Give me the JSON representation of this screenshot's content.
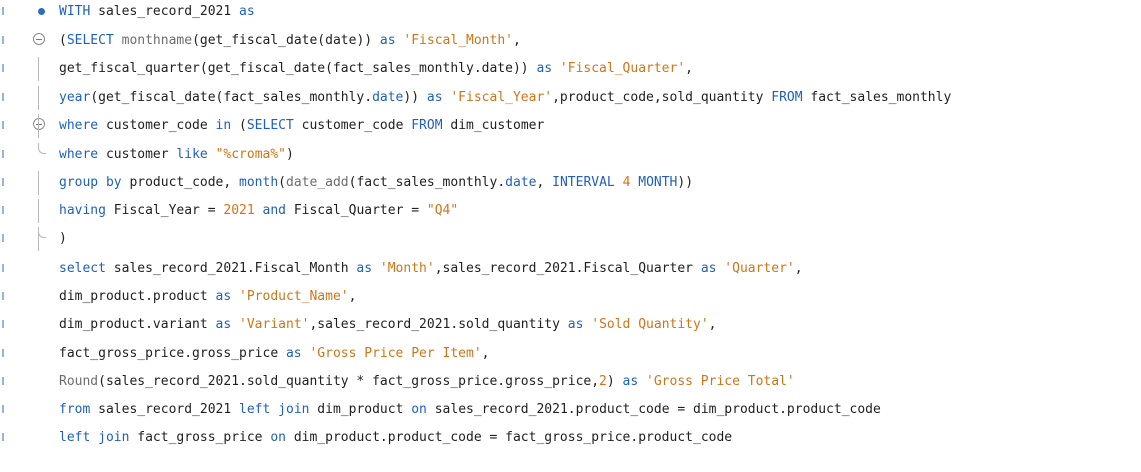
{
  "editor": {
    "lines": [
      [
        {
          "t": "WITH",
          "c": "kw"
        },
        {
          "t": " sales_record_2021 ",
          "c": "plain"
        },
        {
          "t": "as",
          "c": "kw"
        }
      ],
      [
        {
          "t": "(",
          "c": "plain"
        },
        {
          "t": "SELECT",
          "c": "kw"
        },
        {
          "t": " ",
          "c": "plain"
        },
        {
          "t": "monthname",
          "c": "fn"
        },
        {
          "t": "(get_fiscal_date(date)) ",
          "c": "plain"
        },
        {
          "t": "as",
          "c": "kw"
        },
        {
          "t": " ",
          "c": "plain"
        },
        {
          "t": "'Fiscal_Month'",
          "c": "str"
        },
        {
          "t": ",",
          "c": "plain"
        }
      ],
      [
        {
          "t": "get_fiscal_quarter(get_fiscal_date(fact_sales_monthly.date)) ",
          "c": "plain"
        },
        {
          "t": "as",
          "c": "kw"
        },
        {
          "t": " ",
          "c": "plain"
        },
        {
          "t": "'Fiscal_Quarter'",
          "c": "str"
        },
        {
          "t": ",",
          "c": "plain"
        }
      ],
      [
        {
          "t": "year",
          "c": "kw"
        },
        {
          "t": "(get_fiscal_date(fact_sales_monthly.",
          "c": "plain"
        },
        {
          "t": "date",
          "c": "kw"
        },
        {
          "t": ")) ",
          "c": "plain"
        },
        {
          "t": "as",
          "c": "kw"
        },
        {
          "t": " ",
          "c": "plain"
        },
        {
          "t": "'Fiscal_Year'",
          "c": "str"
        },
        {
          "t": ",product_code,sold_quantity ",
          "c": "plain"
        },
        {
          "t": "FROM",
          "c": "kw"
        },
        {
          "t": " fact_sales_monthly",
          "c": "plain"
        }
      ],
      [
        {
          "t": "where",
          "c": "kw"
        },
        {
          "t": " customer_code ",
          "c": "plain"
        },
        {
          "t": "in",
          "c": "kw"
        },
        {
          "t": " (",
          "c": "plain"
        },
        {
          "t": "SELECT",
          "c": "kw"
        },
        {
          "t": " customer_code ",
          "c": "plain"
        },
        {
          "t": "FROM",
          "c": "kw"
        },
        {
          "t": " dim_customer",
          "c": "plain"
        }
      ],
      [
        {
          "t": "where",
          "c": "kw"
        },
        {
          "t": " customer ",
          "c": "plain"
        },
        {
          "t": "like",
          "c": "kw"
        },
        {
          "t": " ",
          "c": "plain"
        },
        {
          "t": "\"%croma%\"",
          "c": "str"
        },
        {
          "t": ")",
          "c": "plain"
        }
      ],
      [
        {
          "t": "group by",
          "c": "kw"
        },
        {
          "t": " product_code, ",
          "c": "plain"
        },
        {
          "t": "month",
          "c": "kw"
        },
        {
          "t": "(",
          "c": "plain"
        },
        {
          "t": "date_add",
          "c": "fn"
        },
        {
          "t": "(fact_sales_monthly.",
          "c": "plain"
        },
        {
          "t": "date",
          "c": "kw"
        },
        {
          "t": ", ",
          "c": "plain"
        },
        {
          "t": "INTERVAL",
          "c": "kw"
        },
        {
          "t": " ",
          "c": "plain"
        },
        {
          "t": "4",
          "c": "num"
        },
        {
          "t": " ",
          "c": "plain"
        },
        {
          "t": "MONTH",
          "c": "kw"
        },
        {
          "t": "))",
          "c": "plain"
        }
      ],
      [
        {
          "t": "having",
          "c": "kw"
        },
        {
          "t": " Fiscal_Year = ",
          "c": "plain"
        },
        {
          "t": "2021",
          "c": "num"
        },
        {
          "t": " ",
          "c": "plain"
        },
        {
          "t": "and",
          "c": "kw"
        },
        {
          "t": " Fiscal_Quarter = ",
          "c": "plain"
        },
        {
          "t": "\"Q4\"",
          "c": "str"
        }
      ],
      [
        {
          "t": ")",
          "c": "plain"
        }
      ],
      [
        {
          "t": "select",
          "c": "kw"
        },
        {
          "t": " sales_record_2021.Fiscal_Month ",
          "c": "plain"
        },
        {
          "t": "as",
          "c": "kw"
        },
        {
          "t": " ",
          "c": "plain"
        },
        {
          "t": "'Month'",
          "c": "str"
        },
        {
          "t": ",sales_record_2021.Fiscal_Quarter ",
          "c": "plain"
        },
        {
          "t": "as",
          "c": "kw"
        },
        {
          "t": " ",
          "c": "plain"
        },
        {
          "t": "'Quarter'",
          "c": "str"
        },
        {
          "t": ",",
          "c": "plain"
        }
      ],
      [
        {
          "t": "dim_product.product ",
          "c": "plain"
        },
        {
          "t": "as",
          "c": "kw"
        },
        {
          "t": " ",
          "c": "plain"
        },
        {
          "t": "'Product_Name'",
          "c": "str"
        },
        {
          "t": ",",
          "c": "plain"
        }
      ],
      [
        {
          "t": "dim_product.variant ",
          "c": "plain"
        },
        {
          "t": "as",
          "c": "kw"
        },
        {
          "t": " ",
          "c": "plain"
        },
        {
          "t": "'Variant'",
          "c": "str"
        },
        {
          "t": ",sales_record_2021.sold_quantity ",
          "c": "plain"
        },
        {
          "t": "as",
          "c": "kw"
        },
        {
          "t": " ",
          "c": "plain"
        },
        {
          "t": "'Sold Quantity'",
          "c": "str"
        },
        {
          "t": ",",
          "c": "plain"
        }
      ],
      [
        {
          "t": "fact_gross_price.gross_price ",
          "c": "plain"
        },
        {
          "t": "as",
          "c": "kw"
        },
        {
          "t": " ",
          "c": "plain"
        },
        {
          "t": "'Gross Price Per Item'",
          "c": "str"
        },
        {
          "t": ",",
          "c": "plain"
        }
      ],
      [
        {
          "t": "Round",
          "c": "fn"
        },
        {
          "t": "(sales_record_2021.sold_quantity * fact_gross_price.gross_price,",
          "c": "plain"
        },
        {
          "t": "2",
          "c": "num"
        },
        {
          "t": ") ",
          "c": "plain"
        },
        {
          "t": "as",
          "c": "kw"
        },
        {
          "t": " ",
          "c": "plain"
        },
        {
          "t": "'Gross Price Total'",
          "c": "str"
        }
      ],
      [
        {
          "t": "from",
          "c": "kw"
        },
        {
          "t": " sales_record_2021 ",
          "c": "plain"
        },
        {
          "t": "left join",
          "c": "kw"
        },
        {
          "t": " dim_product ",
          "c": "plain"
        },
        {
          "t": "on",
          "c": "kw"
        },
        {
          "t": " sales_record_2021.product_code = dim_product.product_code",
          "c": "plain"
        }
      ],
      [
        {
          "t": "left join",
          "c": "kw"
        },
        {
          "t": " fact_gross_price ",
          "c": "plain"
        },
        {
          "t": "on",
          "c": "kw"
        },
        {
          "t": " dim_product.product_code = fact_gross_price.product_code",
          "c": "plain"
        }
      ]
    ]
  },
  "theme": {
    "keyword": "#1f5fbf",
    "function": "#6d6d6d",
    "string": "#d07418",
    "number": "#df6f12",
    "text": "#1f1f1f",
    "background": "#ffffff"
  }
}
